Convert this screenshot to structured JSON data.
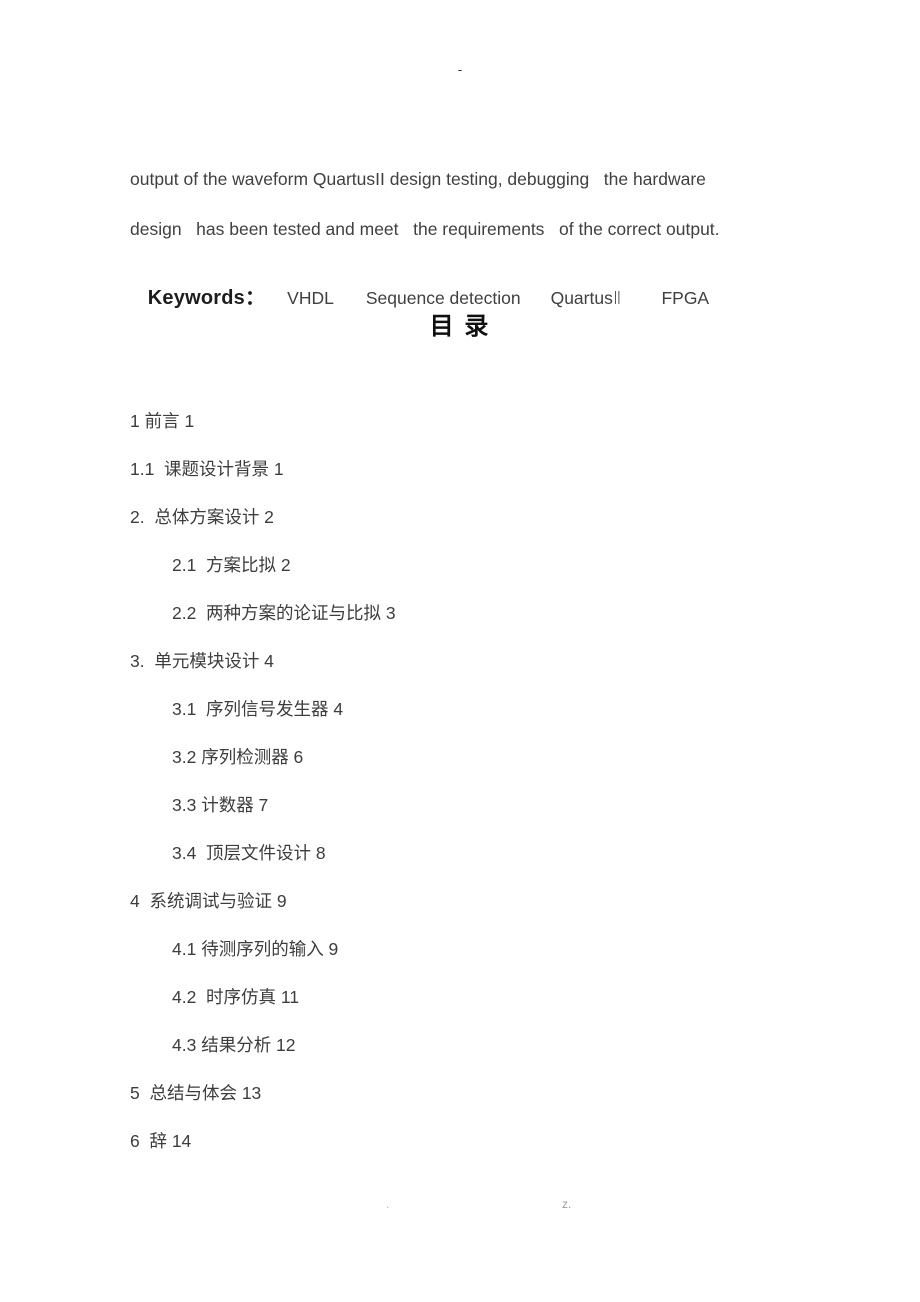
{
  "header": {
    "mark": "-"
  },
  "abstract": {
    "paragraphs": [
      "output of the waveform QuartusII design testing, debugging   the hardware",
      "design   has been tested and meet   the requirements   of the correct output."
    ]
  },
  "keywords": {
    "label": "Keywords：",
    "items": [
      "VHDL",
      "Sequence detection",
      "QuartusⅡ",
      "FPGA"
    ]
  },
  "toc": {
    "title": "目  录",
    "entries": [
      {
        "text": "1 前言 1",
        "level": 1
      },
      {
        "text": "1.1  课题设计背景 1",
        "level": 1
      },
      {
        "text": "2.  总体方案设计 2",
        "level": 1
      },
      {
        "text": "2.1  方案比拟 2",
        "level": 2
      },
      {
        "text": "2.2  两种方案的论证与比拟 3",
        "level": 2
      },
      {
        "text": "3.  单元模块设计 4",
        "level": 1
      },
      {
        "text": "3.1  序列信号发生器 4",
        "level": 2
      },
      {
        "text": "3.2 序列检测器 6",
        "level": 2
      },
      {
        "text": "3.3 计数器 7",
        "level": 2
      },
      {
        "text": "3.4  顶层文件设计 8",
        "level": 2
      },
      {
        "text": "4  系统调试与验证 9",
        "level": 1
      },
      {
        "text": "4.1 待测序列的输入 9",
        "level": 2
      },
      {
        "text": "4.2  时序仿真 11",
        "level": 2
      },
      {
        "text": "4.3 结果分析 12",
        "level": 2
      },
      {
        "text": "5  总结与体会 13",
        "level": 1
      },
      {
        "text": "6  辞 14",
        "level": 1
      }
    ]
  },
  "footer": {
    "left": ".",
    "right": "z."
  }
}
